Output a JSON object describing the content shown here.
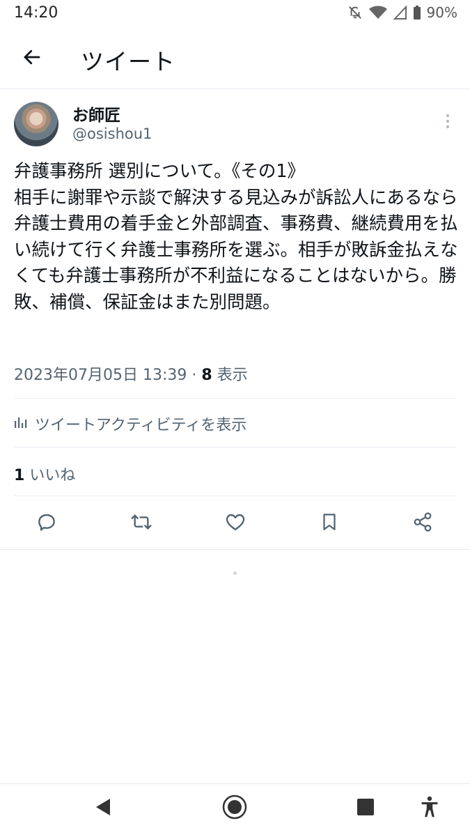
{
  "status_bar": {
    "time": "14:20",
    "battery": "90%",
    "icons": [
      "mute-icon",
      "wifi-icon",
      "signal-icon",
      "battery-icon"
    ]
  },
  "header": {
    "back_icon": "arrow-left-icon",
    "title": "ツイート"
  },
  "tweet": {
    "author_name": "お師匠",
    "author_handle": "@osishou1",
    "text": "弁護事務所 選別について。《その1》\n相手に謝罪や示談で解決する見込みが訴訟人にあるなら弁護士費用の着手金と外部調査、事務費、継続費用を払い続けて行く弁護士事務所を選ぶ。相手が敗訴金払えなくても弁護士事務所が不利益になることはないから。勝敗、補償、保証金はまた別問題。",
    "timestamp": "2023年07月05日 13:39",
    "separator": "·",
    "views_count": "8",
    "views_label": "表示",
    "activity_label": "ツイートアクティビティを表示",
    "likes_count": "1",
    "likes_label": "いいね"
  },
  "actions": [
    "reply-icon",
    "retweet-icon",
    "like-icon",
    "bookmark-icon",
    "share-icon"
  ],
  "nav": [
    "back-triangle-icon",
    "home-circle-icon",
    "recents-square-icon",
    "accessibility-icon"
  ],
  "colors": {
    "text": "#0f1419",
    "secondary": "#536471",
    "divider": "#e6ecf0",
    "icon": "#536471"
  }
}
